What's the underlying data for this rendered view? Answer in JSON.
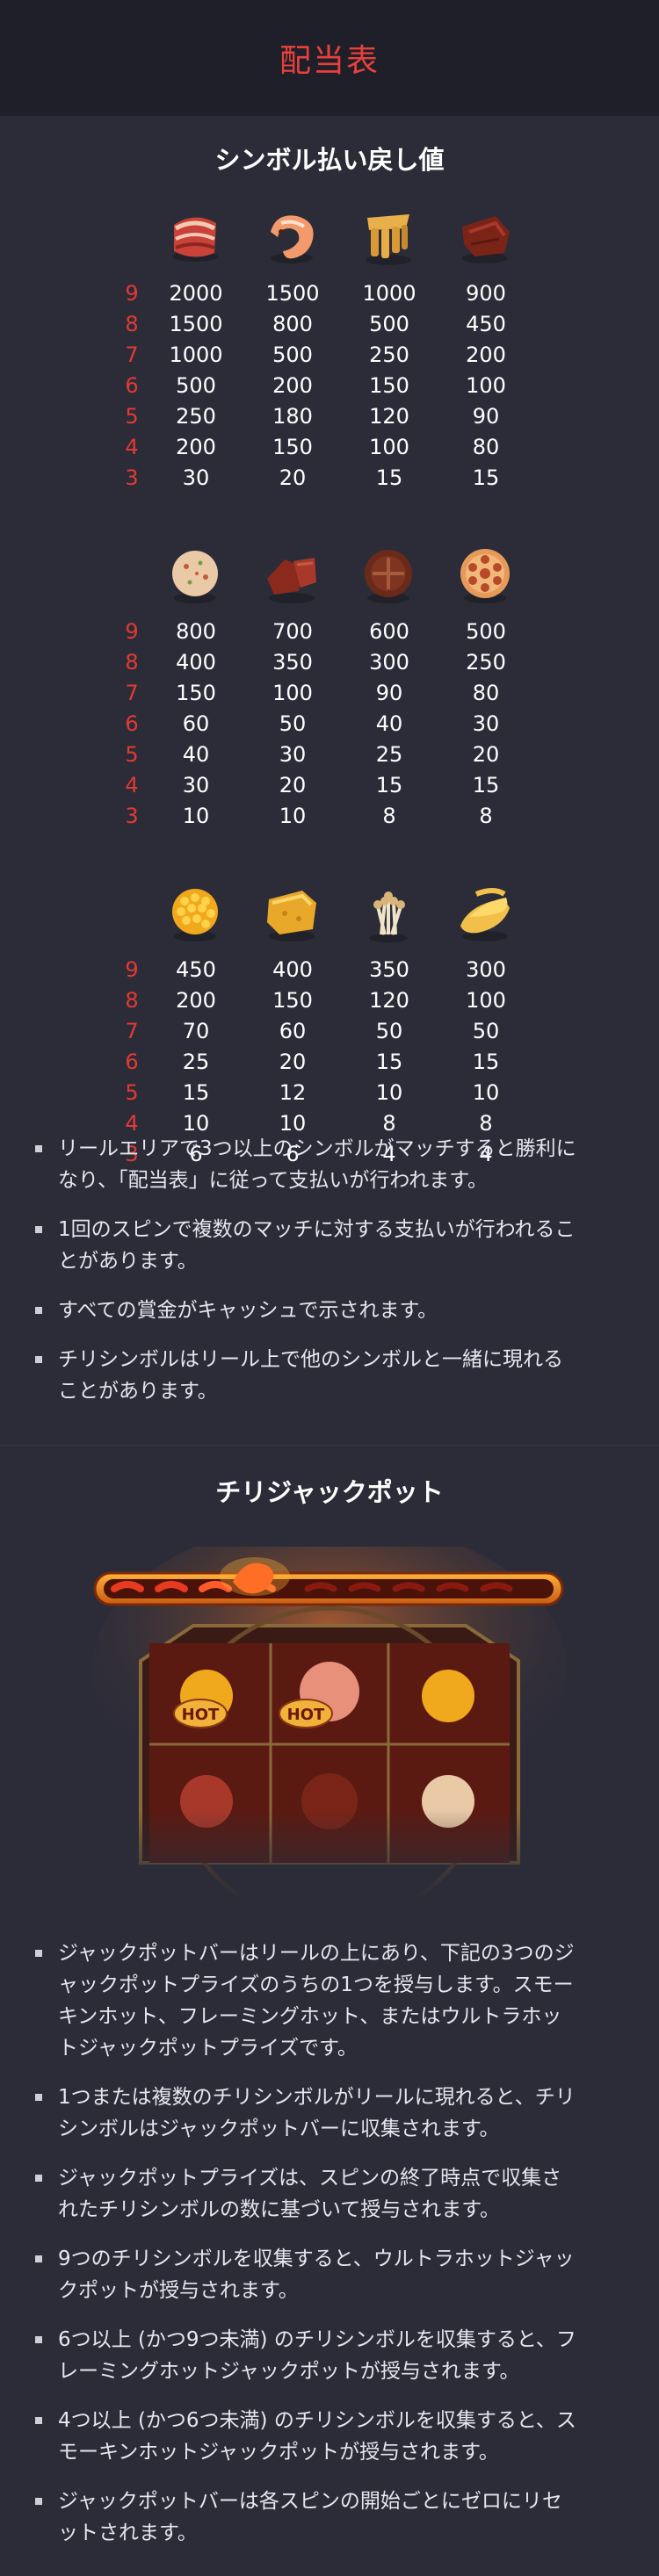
{
  "header": {
    "title": "配当表"
  },
  "paytable": {
    "title": "シンボル払い戻し値",
    "groups": [
      {
        "icons": [
          "bacon-icon",
          "shrimp-icon",
          "tofu-skin-icon",
          "beef-icon"
        ],
        "rows": [
          {
            "count": "9",
            "values": [
              "2000",
              "1500",
              "1000",
              "900"
            ]
          },
          {
            "count": "8",
            "values": [
              "1500",
              "800",
              "500",
              "450"
            ]
          },
          {
            "count": "7",
            "values": [
              "1000",
              "500",
              "250",
              "200"
            ]
          },
          {
            "count": "6",
            "values": [
              "500",
              "200",
              "150",
              "100"
            ]
          },
          {
            "count": "5",
            "values": [
              "250",
              "180",
              "120",
              "90"
            ]
          },
          {
            "count": "4",
            "values": [
              "200",
              "150",
              "100",
              "80"
            ]
          },
          {
            "count": "3",
            "values": [
              "30",
              "20",
              "15",
              "15"
            ]
          }
        ]
      },
      {
        "icons": [
          "fishball-icon",
          "meat-chunk-icon",
          "shiitake-icon",
          "lotus-root-icon"
        ],
        "rows": [
          {
            "count": "9",
            "values": [
              "800",
              "700",
              "600",
              "500"
            ]
          },
          {
            "count": "8",
            "values": [
              "400",
              "350",
              "300",
              "250"
            ]
          },
          {
            "count": "7",
            "values": [
              "150",
              "100",
              "90",
              "80"
            ]
          },
          {
            "count": "6",
            "values": [
              "60",
              "50",
              "40",
              "30"
            ]
          },
          {
            "count": "5",
            "values": [
              "40",
              "30",
              "25",
              "20"
            ]
          },
          {
            "count": "4",
            "values": [
              "30",
              "20",
              "15",
              "15"
            ]
          },
          {
            "count": "3",
            "values": [
              "10",
              "10",
              "8",
              "8"
            ]
          }
        ]
      },
      {
        "icons": [
          "corn-icon",
          "fried-tofu-icon",
          "enoki-icon",
          "potato-slice-icon"
        ],
        "rows": [
          {
            "count": "9",
            "values": [
              "450",
              "400",
              "350",
              "300"
            ]
          },
          {
            "count": "8",
            "values": [
              "200",
              "150",
              "120",
              "100"
            ]
          },
          {
            "count": "7",
            "values": [
              "70",
              "60",
              "50",
              "50"
            ]
          },
          {
            "count": "6",
            "values": [
              "25",
              "20",
              "15",
              "15"
            ]
          },
          {
            "count": "5",
            "values": [
              "15",
              "12",
              "10",
              "10"
            ]
          },
          {
            "count": "4",
            "values": [
              "10",
              "10",
              "8",
              "8"
            ]
          },
          {
            "count": "3",
            "values": [
              "6",
              "6",
              "4",
              "4"
            ]
          }
        ]
      }
    ],
    "rules": [
      {
        "lines": [
          "リールエリアで3つ以上のシンボルがマッチすると勝利に",
          "なり、「配当表」に従って支払いが行われます。"
        ]
      },
      {
        "lines": [
          "1回のスピンで複数のマッチに対する支払いが行われるこ",
          "とがあります。"
        ]
      },
      {
        "lines": [
          "すべての賞金がキャッシュで示されます。"
        ]
      },
      {
        "lines": [
          "チリシンボルはリール上で他のシンボルと一緒に現れる",
          "ことがあります。"
        ]
      }
    ]
  },
  "jackpot": {
    "title": "チリジャックポット",
    "hot_badge": "HOT",
    "art_icons": [
      "chili-icon",
      "jackpot-bar-icon",
      "hot-badge-icon",
      "reel-grid-icon"
    ],
    "rules": [
      {
        "lines": [
          "ジャックポットバーはリールの上にあり、下記の3つのジ",
          "ャックポットプライズのうちの1つを授与します。スモー",
          "キンホット、フレーミングホット、またはウルトラホッ",
          "トジャックポットプライズです。"
        ]
      },
      {
        "lines": [
          "1つまたは複数のチリシンボルがリールに現れると、チリ",
          "シンボルはジャックポットバーに収集されます。"
        ]
      },
      {
        "lines": [
          "ジャックポットプライズは、スピンの終了時点で収集さ",
          "れたチリシンボルの数に基づいて授与されます。"
        ]
      },
      {
        "lines": [
          "9つのチリシンボルを収集すると、ウルトラホットジャッ",
          "クポットが授与されます。"
        ]
      },
      {
        "lines": [
          "6つ以上 (かつ9つ未満) のチリシンボルを収集すると、フ",
          "レーミングホットジャックポットが授与されます。"
        ]
      },
      {
        "lines": [
          "4つ以上 (かつ6つ未満) のチリシンボルを収集すると、ス",
          "モーキンホットジャックポットが授与されます。"
        ]
      },
      {
        "lines": [
          "ジャックポットバーは各スピンの開始ごとにゼロにリセ",
          "ットされます。"
        ]
      }
    ]
  },
  "colors": {
    "accent_red": "#e23a33",
    "header_bg": "#1f1f29",
    "page_bg": "#2c2c38"
  }
}
